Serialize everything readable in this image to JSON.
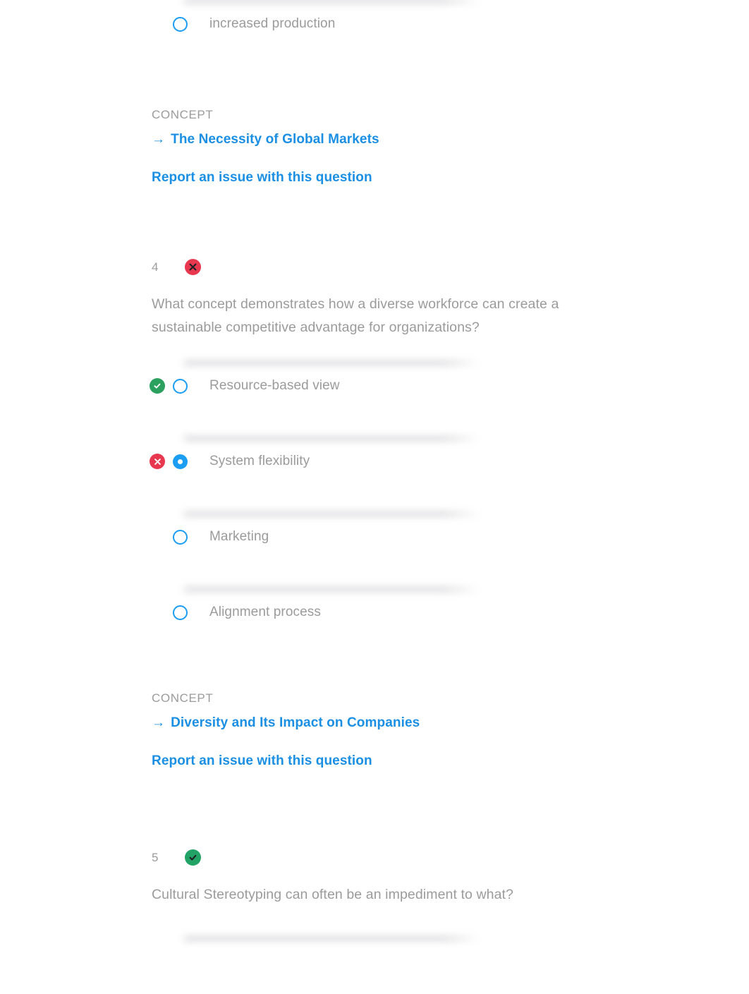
{
  "colors": {
    "correct_green": "#21a366",
    "incorrect_red": "#e8384f",
    "radio_blue": "#1b9df3",
    "link_blue": "#1b8fe3",
    "text_gray": "#9b9b9b"
  },
  "partial_question_top": {
    "options": [
      {
        "label": "increased production",
        "selected": false,
        "status": "none"
      }
    ],
    "concept_heading": "CONCEPT",
    "concept_arrow": "→",
    "concept_link": "The Necessity of Global Markets",
    "report_link": "Report an issue with this question"
  },
  "questions": [
    {
      "number": "4",
      "status": "incorrect",
      "text": "What concept demonstrates how a diverse workforce can create a sustainable competitive advantage for organizations?",
      "options": [
        {
          "label": "Resource-based view",
          "selected": false,
          "status": "correct"
        },
        {
          "label": "System flexibility",
          "selected": true,
          "status": "incorrect"
        },
        {
          "label": "Marketing",
          "selected": false,
          "status": "none"
        },
        {
          "label": "Alignment process",
          "selected": false,
          "status": "none"
        }
      ],
      "concept_heading": "CONCEPT",
      "concept_arrow": "→",
      "concept_link": "Diversity and Its Impact on Companies",
      "report_link": "Report an issue with this question"
    },
    {
      "number": "5",
      "status": "correct",
      "text": "Cultural Stereotyping can often be an impediment to what?",
      "options": [],
      "concept_heading": "",
      "concept_arrow": "",
      "concept_link": "",
      "report_link": ""
    }
  ]
}
